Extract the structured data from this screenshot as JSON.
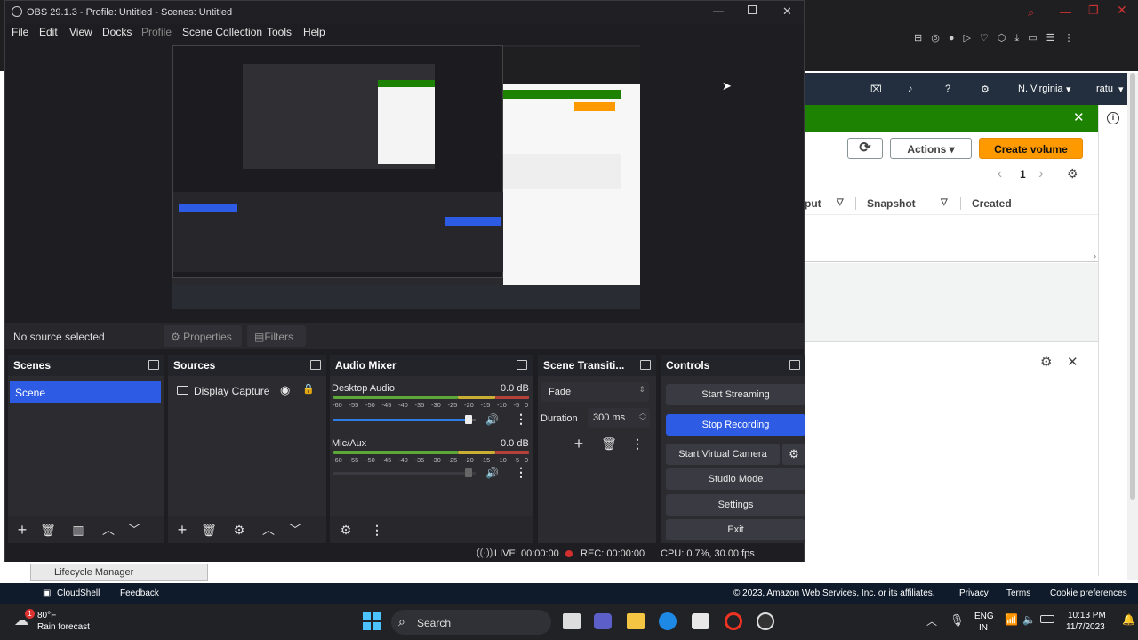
{
  "browser": {
    "aws_nav": {
      "region": "N. Virginia",
      "user": "ratu"
    },
    "actions_label": "Actions",
    "create_volume_label": "Create volume",
    "page_number": "1",
    "columns": [
      "put",
      "Snapshot",
      "Created"
    ],
    "footer": {
      "cloudshell": "CloudShell",
      "feedback": "Feedback",
      "copyright": "© 2023, Amazon Web Services, Inc. or its affiliates.",
      "privacy": "Privacy",
      "terms": "Terms",
      "cookies": "Cookie preferences"
    },
    "lifecycle_label": "Lifecycle Manager"
  },
  "obs": {
    "title": "OBS 29.1.3 - Profile: Untitled - Scenes: Untitled",
    "menu": [
      "File",
      "Edit",
      "View",
      "Docks",
      "Profile",
      "Scene Collection",
      "Tools",
      "Help"
    ],
    "source_status": "No source selected",
    "properties_label": "Properties",
    "filters_label": "Filters",
    "scenes": {
      "title": "Scenes",
      "items": [
        "Scene"
      ]
    },
    "sources": {
      "title": "Sources",
      "items": [
        "Display Capture"
      ]
    },
    "audio_mixer": {
      "title": "Audio Mixer",
      "channels": [
        {
          "name": "Desktop Audio",
          "db": "0.0 dB",
          "volume": 0.95
        },
        {
          "name": "Mic/Aux",
          "db": "0.0 dB",
          "volume": 0.95
        }
      ],
      "ticks": [
        "-60",
        "-55",
        "-50",
        "-45",
        "-40",
        "-35",
        "-30",
        "-25",
        "-20",
        "-15",
        "-10",
        "-5",
        "0"
      ]
    },
    "transitions": {
      "title": "Scene Transiti...",
      "selected": "Fade",
      "duration_label": "Duration",
      "duration_value": "300 ms"
    },
    "controls": {
      "title": "Controls",
      "start_streaming": "Start Streaming",
      "stop_recording": "Stop Recording",
      "start_virtual_camera": "Start Virtual Camera",
      "studio_mode": "Studio Mode",
      "settings": "Settings",
      "exit": "Exit"
    },
    "status": {
      "live": "LIVE: 00:00:00",
      "rec": "REC: 00:00:00",
      "cpu": "CPU: 0.7%, 30.00 fps"
    }
  },
  "taskbar": {
    "weather_temp": "80°F",
    "weather_desc": "Rain forecast",
    "search": "Search",
    "lang": "ENG",
    "region": "IN",
    "time": "10:13 PM",
    "date": "11/7/2023"
  },
  "colors": {
    "accent": "#2d5be3",
    "aws_orange": "#ff9900",
    "aws_green": "#1d8102",
    "rec_red": "#d32f2f"
  }
}
